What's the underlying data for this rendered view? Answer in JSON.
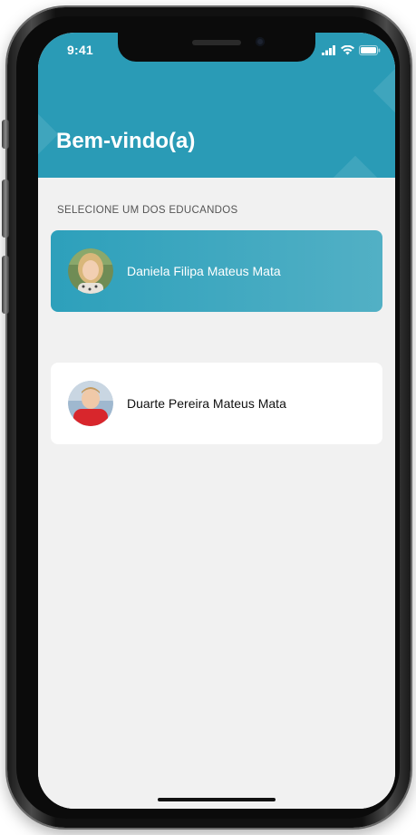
{
  "status_bar": {
    "time": "9:41",
    "signal_icon": "signal-bars-icon",
    "wifi_icon": "wifi-icon",
    "battery_icon": "battery-icon"
  },
  "header": {
    "title": "Bem-vindo(a)",
    "background_color": "#2a9bb6"
  },
  "main": {
    "section_label": "SELECIONE UM DOS EDUCANDOS",
    "students": [
      {
        "name": "Daniela Filipa Mateus Mata",
        "selected": true,
        "avatar": "avatar-photo"
      },
      {
        "name": "Duarte Pereira Mateus Mata",
        "selected": false,
        "avatar": "avatar-photo"
      }
    ]
  },
  "colors": {
    "accent": "#2a9bb6",
    "screen_background": "#f1f1f1",
    "card_background": "#ffffff"
  }
}
